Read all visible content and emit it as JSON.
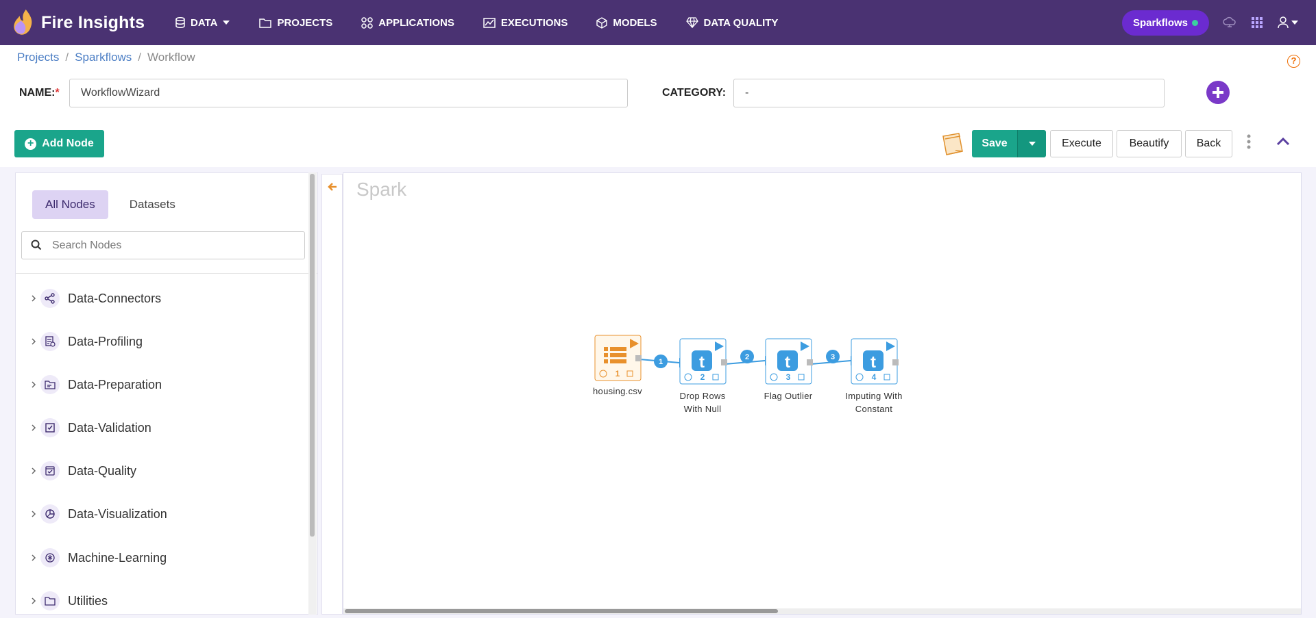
{
  "app": {
    "brand_name": "Fire Insights",
    "nav": [
      {
        "label": "DATA",
        "icon": "database-icon"
      },
      {
        "label": "PROJECTS",
        "icon": "folder-icon"
      },
      {
        "label": "APPLICATIONS",
        "icon": "apps-icon"
      },
      {
        "label": "EXECUTIONS",
        "icon": "chart-icon"
      },
      {
        "label": "MODELS",
        "icon": "cube-icon"
      },
      {
        "label": "DATA QUALITY",
        "icon": "diamond-icon"
      }
    ],
    "project_pill": "Sparkflows",
    "colors": {
      "nav_bg": "#4a3272",
      "accent": "#1aa58b",
      "pill": "#6b2bd0",
      "node_orange": "#e8902c",
      "node_blue": "#3c9ce0"
    }
  },
  "breadcrumb": [
    "Projects",
    "Sparkflows",
    "Workflow"
  ],
  "form": {
    "name_label": "NAME:",
    "name_required": "*",
    "name_value": "WorkflowWizard",
    "category_label": "CATEGORY:",
    "category_value": "-"
  },
  "toolbar": {
    "add_node": "Add Node",
    "save": "Save",
    "execute": "Execute",
    "beautify": "Beautify",
    "back": "Back"
  },
  "sidebar": {
    "tabs": [
      "All Nodes",
      "Datasets"
    ],
    "search_placeholder": "Search Nodes",
    "categories": [
      "Data-Connectors",
      "Data-Profiling",
      "Data-Preparation",
      "Data-Validation",
      "Data-Quality",
      "Data-Visualization",
      "Machine-Learning",
      "Utilities"
    ]
  },
  "canvas": {
    "title": "Spark",
    "nodes": [
      {
        "number": "1",
        "label_lines": [
          "housing.csv"
        ],
        "type": "dataset"
      },
      {
        "number": "2",
        "label_lines": [
          "Drop Rows",
          "With Null"
        ],
        "type": "transform"
      },
      {
        "number": "3",
        "label_lines": [
          "Flag Outlier"
        ],
        "type": "transform"
      },
      {
        "number": "4",
        "label_lines": [
          "Imputing With",
          "Constant"
        ],
        "type": "transform"
      }
    ],
    "edges": [
      "1",
      "2",
      "3"
    ]
  }
}
